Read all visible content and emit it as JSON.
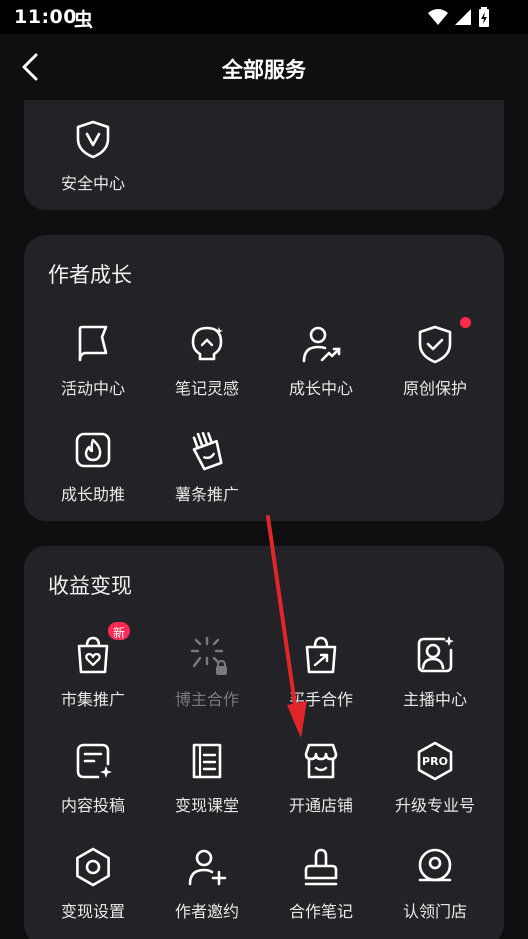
{
  "status_bar": {
    "time": "11:00",
    "extra": "虫"
  },
  "header": {
    "title": "全部服务"
  },
  "sections": [
    {
      "title": "",
      "items": [
        {
          "label": "安全中心",
          "icon": "shield-v-icon"
        }
      ]
    },
    {
      "title": "作者成长",
      "items": [
        {
          "label": "活动中心",
          "icon": "flag-icon"
        },
        {
          "label": "笔记灵感",
          "icon": "lightbulb-icon"
        },
        {
          "label": "成长中心",
          "icon": "user-trend-icon"
        },
        {
          "label": "原创保护",
          "icon": "shield-check-icon",
          "red_dot": true
        },
        {
          "label": "成长助推",
          "icon": "flame-icon"
        },
        {
          "label": "薯条推广",
          "icon": "fries-icon"
        }
      ]
    },
    {
      "title": "收益变现",
      "items": [
        {
          "label": "市集推广",
          "icon": "bag-heart-icon",
          "badge": "新"
        },
        {
          "label": "博主合作",
          "icon": "sparkle-lock-icon",
          "disabled": true
        },
        {
          "label": "买手合作",
          "icon": "shopping-bag-icon"
        },
        {
          "label": "主播中心",
          "icon": "streamer-icon"
        },
        {
          "label": "内容投稿",
          "icon": "document-submit-icon"
        },
        {
          "label": "变现课堂",
          "icon": "book-icon"
        },
        {
          "label": "开通店铺",
          "icon": "store-icon"
        },
        {
          "label": "升级专业号",
          "icon": "pro-badge-icon",
          "pro_text": "PRO"
        },
        {
          "label": "变现设置",
          "icon": "gear-icon"
        },
        {
          "label": "作者邀约",
          "icon": "add-user-icon"
        },
        {
          "label": "合作笔记",
          "icon": "stamp-icon"
        },
        {
          "label": "认领门店",
          "icon": "location-pin-icon"
        }
      ]
    }
  ],
  "colors": {
    "background": "#0f0f11",
    "card": "#232327",
    "accent_red": "#ff2b4a",
    "arrow": "#e0262a"
  }
}
